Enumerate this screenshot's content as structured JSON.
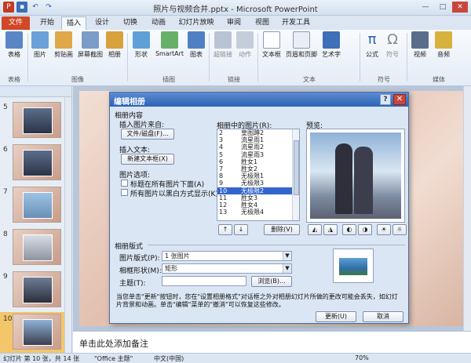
{
  "window": {
    "title": "照片与视频合并.pptx - Microsoft PowerPoint",
    "controls": [
      "—",
      "□",
      "✕"
    ]
  },
  "tabs": [
    {
      "label": "文件"
    },
    {
      "label": "开始"
    },
    {
      "label": "插入"
    },
    {
      "label": "设计"
    },
    {
      "label": "切换"
    },
    {
      "label": "动画"
    },
    {
      "label": "幻灯片放映"
    },
    {
      "label": "审阅"
    },
    {
      "label": "视图"
    },
    {
      "label": "开发工具"
    }
  ],
  "ribbon": {
    "buttons": [
      {
        "label": "表格",
        "icon": "table-icon"
      },
      {
        "label": "图片",
        "icon": "picture-icon"
      },
      {
        "label": "剪贴画",
        "icon": "clipart-icon"
      },
      {
        "label": "屏幕截图",
        "icon": "screenshot-icon"
      },
      {
        "label": "相册",
        "icon": "album-icon"
      },
      {
        "label": "形状",
        "icon": "shapes-icon"
      },
      {
        "label": "SmartArt",
        "icon": "smartart-icon"
      },
      {
        "label": "图表",
        "icon": "chart-icon"
      },
      {
        "label": "超链接",
        "icon": "hyperlink-icon"
      },
      {
        "label": "动作",
        "icon": "action-icon"
      },
      {
        "label": "文本框",
        "icon": "textbox-icon"
      },
      {
        "label": "页眉和页脚",
        "icon": "header-footer-icon"
      },
      {
        "label": "艺术字",
        "icon": "wordart-icon"
      },
      {
        "label": "公式",
        "icon": "equation-icon"
      },
      {
        "label": "符号",
        "icon": "symbol-icon"
      },
      {
        "label": "视频",
        "icon": "video-icon"
      },
      {
        "label": "音频",
        "icon": "audio-icon"
      }
    ],
    "groups": [
      "表格",
      "图像",
      "插图",
      "链接",
      "文本",
      "符号",
      "媒体"
    ]
  },
  "slides": [
    {
      "number": "5"
    },
    {
      "number": "6"
    },
    {
      "number": "7"
    },
    {
      "number": "8"
    },
    {
      "number": "9"
    },
    {
      "number": "10"
    }
  ],
  "notes_placeholder": "单击此处添加备注",
  "status": {
    "slide": "幻灯片 第 10 张，共 14 张",
    "theme": "\"Office 主题\"",
    "language": "中文(中国)",
    "zoom": "70%"
  },
  "dialog": {
    "title": "编辑相册",
    "help": "?",
    "close": "✕",
    "content_label": "相册内容",
    "insert_from": "插入图片来自:",
    "file_disk_button": "文件/磁盘(F)...",
    "insert_text": "插入文本:",
    "new_textbox_button": "新建文本框(X)",
    "picture_options": "图片选项:",
    "caption_option": "标题在所有图片下面(A)",
    "bw_option": "所有图片以黑白方式显示(K)",
    "list_label": "相册中的图片(R):",
    "list_items": [
      {
        "n": "2",
        "v": "皇图蹲2"
      },
      {
        "n": "3",
        "v": "流星雨1"
      },
      {
        "n": "4",
        "v": "流星雨2"
      },
      {
        "n": "5",
        "v": "流星雨3"
      },
      {
        "n": "6",
        "v": "胜女1"
      },
      {
        "n": "7",
        "v": "胜女2"
      },
      {
        "n": "8",
        "v": "无极限1"
      },
      {
        "n": "9",
        "v": "无极限3"
      },
      {
        "n": "10",
        "v": "无极限2"
      },
      {
        "n": "11",
        "v": "胜女3"
      },
      {
        "n": "12",
        "v": "胜女4"
      },
      {
        "n": "13",
        "v": "无极限4"
      }
    ],
    "selected_index": 8,
    "preview_label": "预览:",
    "move_up": "↑",
    "move_down": "↓",
    "delete_button": "删除(V)",
    "layout_label": "相册版式",
    "picture_layout_label": "图片版式(P):",
    "picture_layout_value": "1 张图片",
    "frame_shape_label": "相框形状(M):",
    "frame_shape_value": "矩形",
    "theme_label": "主题(T):",
    "browse_button": "浏览(B)...",
    "note": "当您单击\"更新\"按钮时，您在\"设置相册格式\"对话框之外对相册幻灯片所做的更改可能会丢失，如幻灯片背景和动画。单击\"编辑\"菜单的\"撤消\"可以恢复这些修改。",
    "update_button": "更新(U)",
    "cancel_button": "取消"
  }
}
